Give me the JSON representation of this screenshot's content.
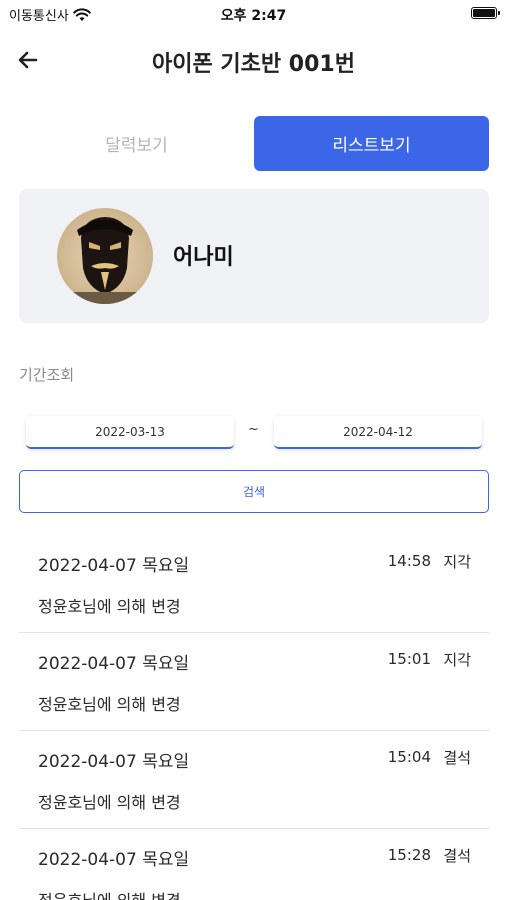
{
  "status_bar": {
    "carrier": "이동통신사",
    "time": "오후 2:47",
    "battery_level": 1.0
  },
  "header": {
    "title": "아이폰 기초반 001번",
    "back_icon": "arrow-left-icon"
  },
  "view_toggle": {
    "calendar_label": "달력보기",
    "list_label": "리스트보기",
    "selected": "list",
    "accent_color": "#3c66e8"
  },
  "profile": {
    "name": "어나미",
    "avatar_icon": "avatar-photo"
  },
  "period": {
    "label": "기간조회",
    "start_date": "2022-03-13",
    "separator": "~",
    "end_date": "2022-04-12"
  },
  "search_button": {
    "label": "검색"
  },
  "records": [
    {
      "date": "2022-04-07 목요일",
      "time": "14:58",
      "status": "지각",
      "note": "정윤호님에 의해 변경"
    },
    {
      "date": "2022-04-07 목요일",
      "time": "15:01",
      "status": "지각",
      "note": "정윤호님에 의해 변경"
    },
    {
      "date": "2022-04-07 목요일",
      "time": "15:04",
      "status": "결석",
      "note": "정윤호님에 의해 변경"
    },
    {
      "date": "2022-04-07 목요일",
      "time": "15:28",
      "status": "결석",
      "note": "정윤호님에 의해 변경"
    }
  ]
}
